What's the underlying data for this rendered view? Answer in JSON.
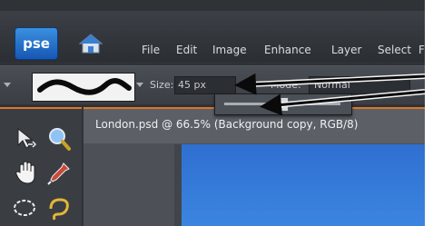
{
  "app": {
    "logo_text": "pse",
    "accent": "#d9772a"
  },
  "menu": {
    "items": [
      "File",
      "Edit",
      "Image",
      "Enhance",
      "Layer",
      "Select",
      "F"
    ]
  },
  "options": {
    "size_label": "Size:",
    "size_value": "45 px",
    "mode_label": "Mode:",
    "mode_value": "Normal",
    "size_slider_level": 0.5
  },
  "document": {
    "title": "London.psd @ 66.5% (Background copy, RGB/8)"
  },
  "tools": [
    "move-icon",
    "zoom-icon",
    "hand-icon",
    "eyedropper-icon",
    "lasso-icon",
    "quick-selection-icon"
  ]
}
